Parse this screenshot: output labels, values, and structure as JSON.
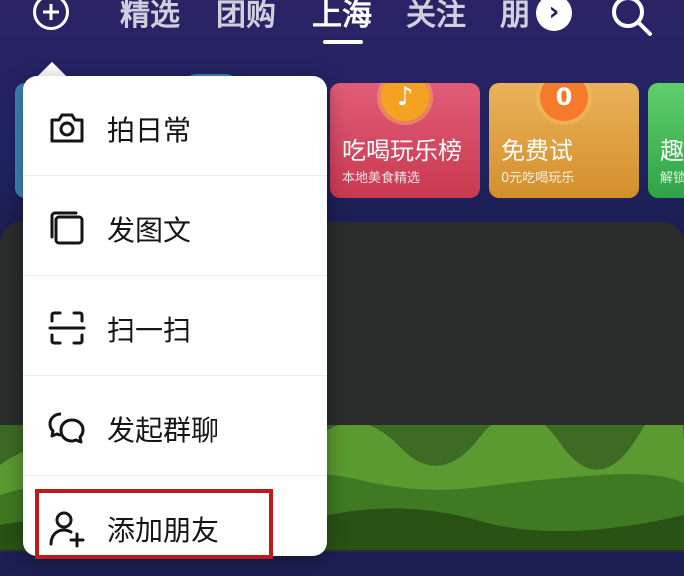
{
  "topbar": {
    "tabs": [
      {
        "label": "精选",
        "active": false
      },
      {
        "label": "团购",
        "active": false
      },
      {
        "label": "上海",
        "active": true
      },
      {
        "label": "关注",
        "active": false
      },
      {
        "label": "朋",
        "active": false
      }
    ],
    "more_glyph": "›"
  },
  "cards": [
    {
      "title": "吃喝玩乐榜",
      "subtitle": "本地美食精选",
      "badge": "♪"
    },
    {
      "title": "免费试",
      "subtitle": "0元吃喝玩乐",
      "badge": "0"
    },
    {
      "title": "趣",
      "subtitle": "解锁"
    }
  ],
  "menu": {
    "items": [
      {
        "label": "拍日常",
        "icon": "camera-icon"
      },
      {
        "label": "发图文",
        "icon": "image-post-icon"
      },
      {
        "label": "扫一扫",
        "icon": "scan-icon"
      },
      {
        "label": "发起群聊",
        "icon": "group-chat-icon"
      },
      {
        "label": "添加朋友",
        "icon": "add-friend-icon",
        "highlighted": true
      }
    ]
  },
  "colors": {
    "background": "#1d1f54",
    "menu_bg": "#ffffff",
    "highlight_border": "#c21a1a",
    "card_food": "#e25c78",
    "card_free": "#e9b25a",
    "card_fun": "#5fcf6a"
  }
}
